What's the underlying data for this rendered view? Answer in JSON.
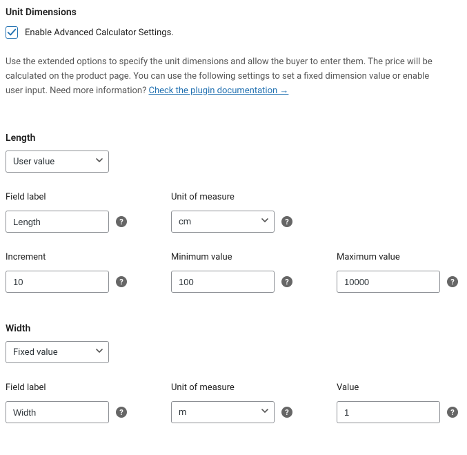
{
  "section_title": "Unit Dimensions",
  "enable_label": "Enable Advanced Calculator Settings.",
  "description_text": "Use the extended options to specify the unit dimensions and allow the buyer to enter them. The price will be calculated on the product page. You can use the following settings to set a fixed dimension value or enable user input. Need more information? ",
  "doc_link_text": "Check the plugin documentation →",
  "length": {
    "title": "Length",
    "mode": "User value",
    "field_label_caption": "Field label",
    "field_label_value": "Length",
    "unit_caption": "Unit of measure",
    "unit_value": "cm",
    "increment_caption": "Increment",
    "increment_value": "10",
    "min_caption": "Minimum value",
    "min_value": "100",
    "max_caption": "Maximum value",
    "max_value": "10000"
  },
  "width": {
    "title": "Width",
    "mode": "Fixed value",
    "field_label_caption": "Field label",
    "field_label_value": "Width",
    "unit_caption": "Unit of measure",
    "unit_value": "m",
    "value_caption": "Value",
    "value_value": "1"
  }
}
